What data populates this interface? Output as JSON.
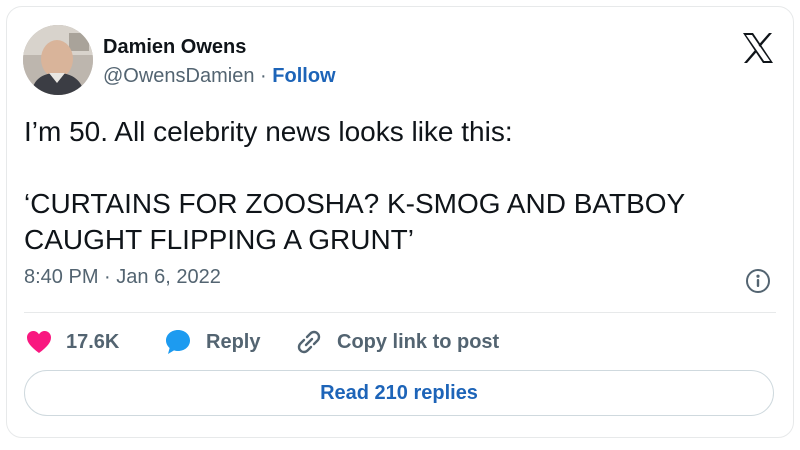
{
  "author": {
    "name": "Damien Owens",
    "handle": "@OwensDamien",
    "separator": "·",
    "follow_label": "Follow",
    "avatar_icon": "profile-photo"
  },
  "tweet": {
    "line1": "I’m 50. All celebrity news looks like this:",
    "line2": "‘CURTAINS FOR ZOOSHA? K-SMOG AND BATBOY CAUGHT FLIPPING A GRUNT’"
  },
  "meta": {
    "time": "8:40 PM",
    "separator": "·",
    "date": "Jan 6, 2022"
  },
  "actions": {
    "likes": "17.6K",
    "reply_label": "Reply",
    "copy_label": "Copy link to post"
  },
  "read_replies_label": "Read 210 replies",
  "colors": {
    "like": "#f91880",
    "reply": "#1d9bf0",
    "link": "#1d64b8",
    "secondary_text": "#536471"
  }
}
